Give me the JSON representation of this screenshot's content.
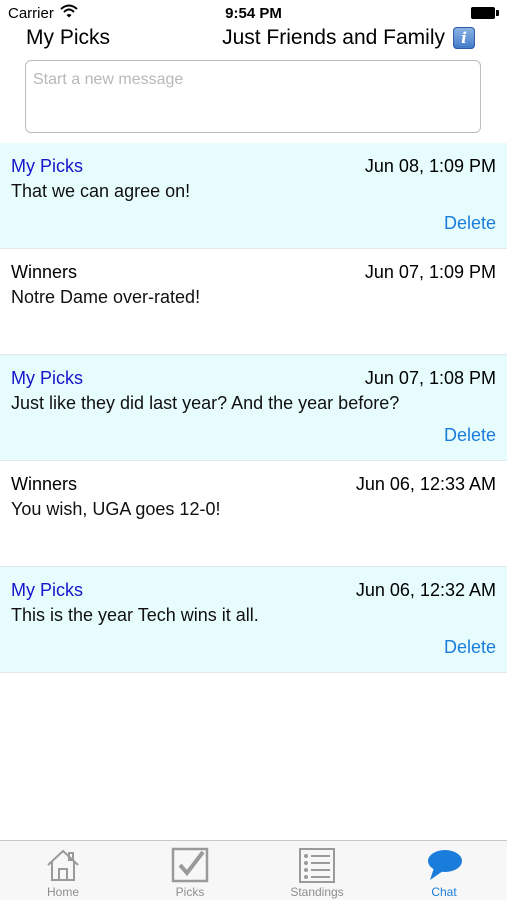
{
  "status_bar": {
    "carrier": "Carrier",
    "time": "9:54 PM"
  },
  "header": {
    "title": "My Picks",
    "group_name": "Just Friends and Family",
    "info_icon": "i"
  },
  "compose": {
    "placeholder": "Start a new message"
  },
  "messages": [
    {
      "sender": "My Picks",
      "date": "Jun 08, 1:09 PM",
      "text": "That we can agree on!",
      "mine": true,
      "delete_label": "Delete"
    },
    {
      "sender": "Winners",
      "date": "Jun 07, 1:09 PM",
      "text": "Notre Dame over-rated!",
      "mine": false
    },
    {
      "sender": "My Picks",
      "date": "Jun 07, 1:08 PM",
      "text": "Just like they did last year?  And the year before?",
      "mine": true,
      "delete_label": "Delete"
    },
    {
      "sender": "Winners",
      "date": "Jun 06, 12:33 AM",
      "text": "You wish, UGA goes 12-0!",
      "mine": false
    },
    {
      "sender": "My Picks",
      "date": "Jun 06, 12:32 AM",
      "text": "This is the year Tech wins it all.",
      "mine": true,
      "delete_label": "Delete"
    }
  ],
  "tabbar": {
    "tabs": [
      {
        "label": "Home",
        "icon": "home-icon"
      },
      {
        "label": "Picks",
        "icon": "checkbox-icon"
      },
      {
        "label": "Standings",
        "icon": "list-icon"
      },
      {
        "label": "Chat",
        "icon": "chat-bubble-icon",
        "active": true
      }
    ]
  },
  "colors": {
    "my_message_bg": "#e6fcfd",
    "my_sender": "#1515cc",
    "accent_blue": "#1a7ddb",
    "tab_inactive": "#8e8e8e"
  }
}
